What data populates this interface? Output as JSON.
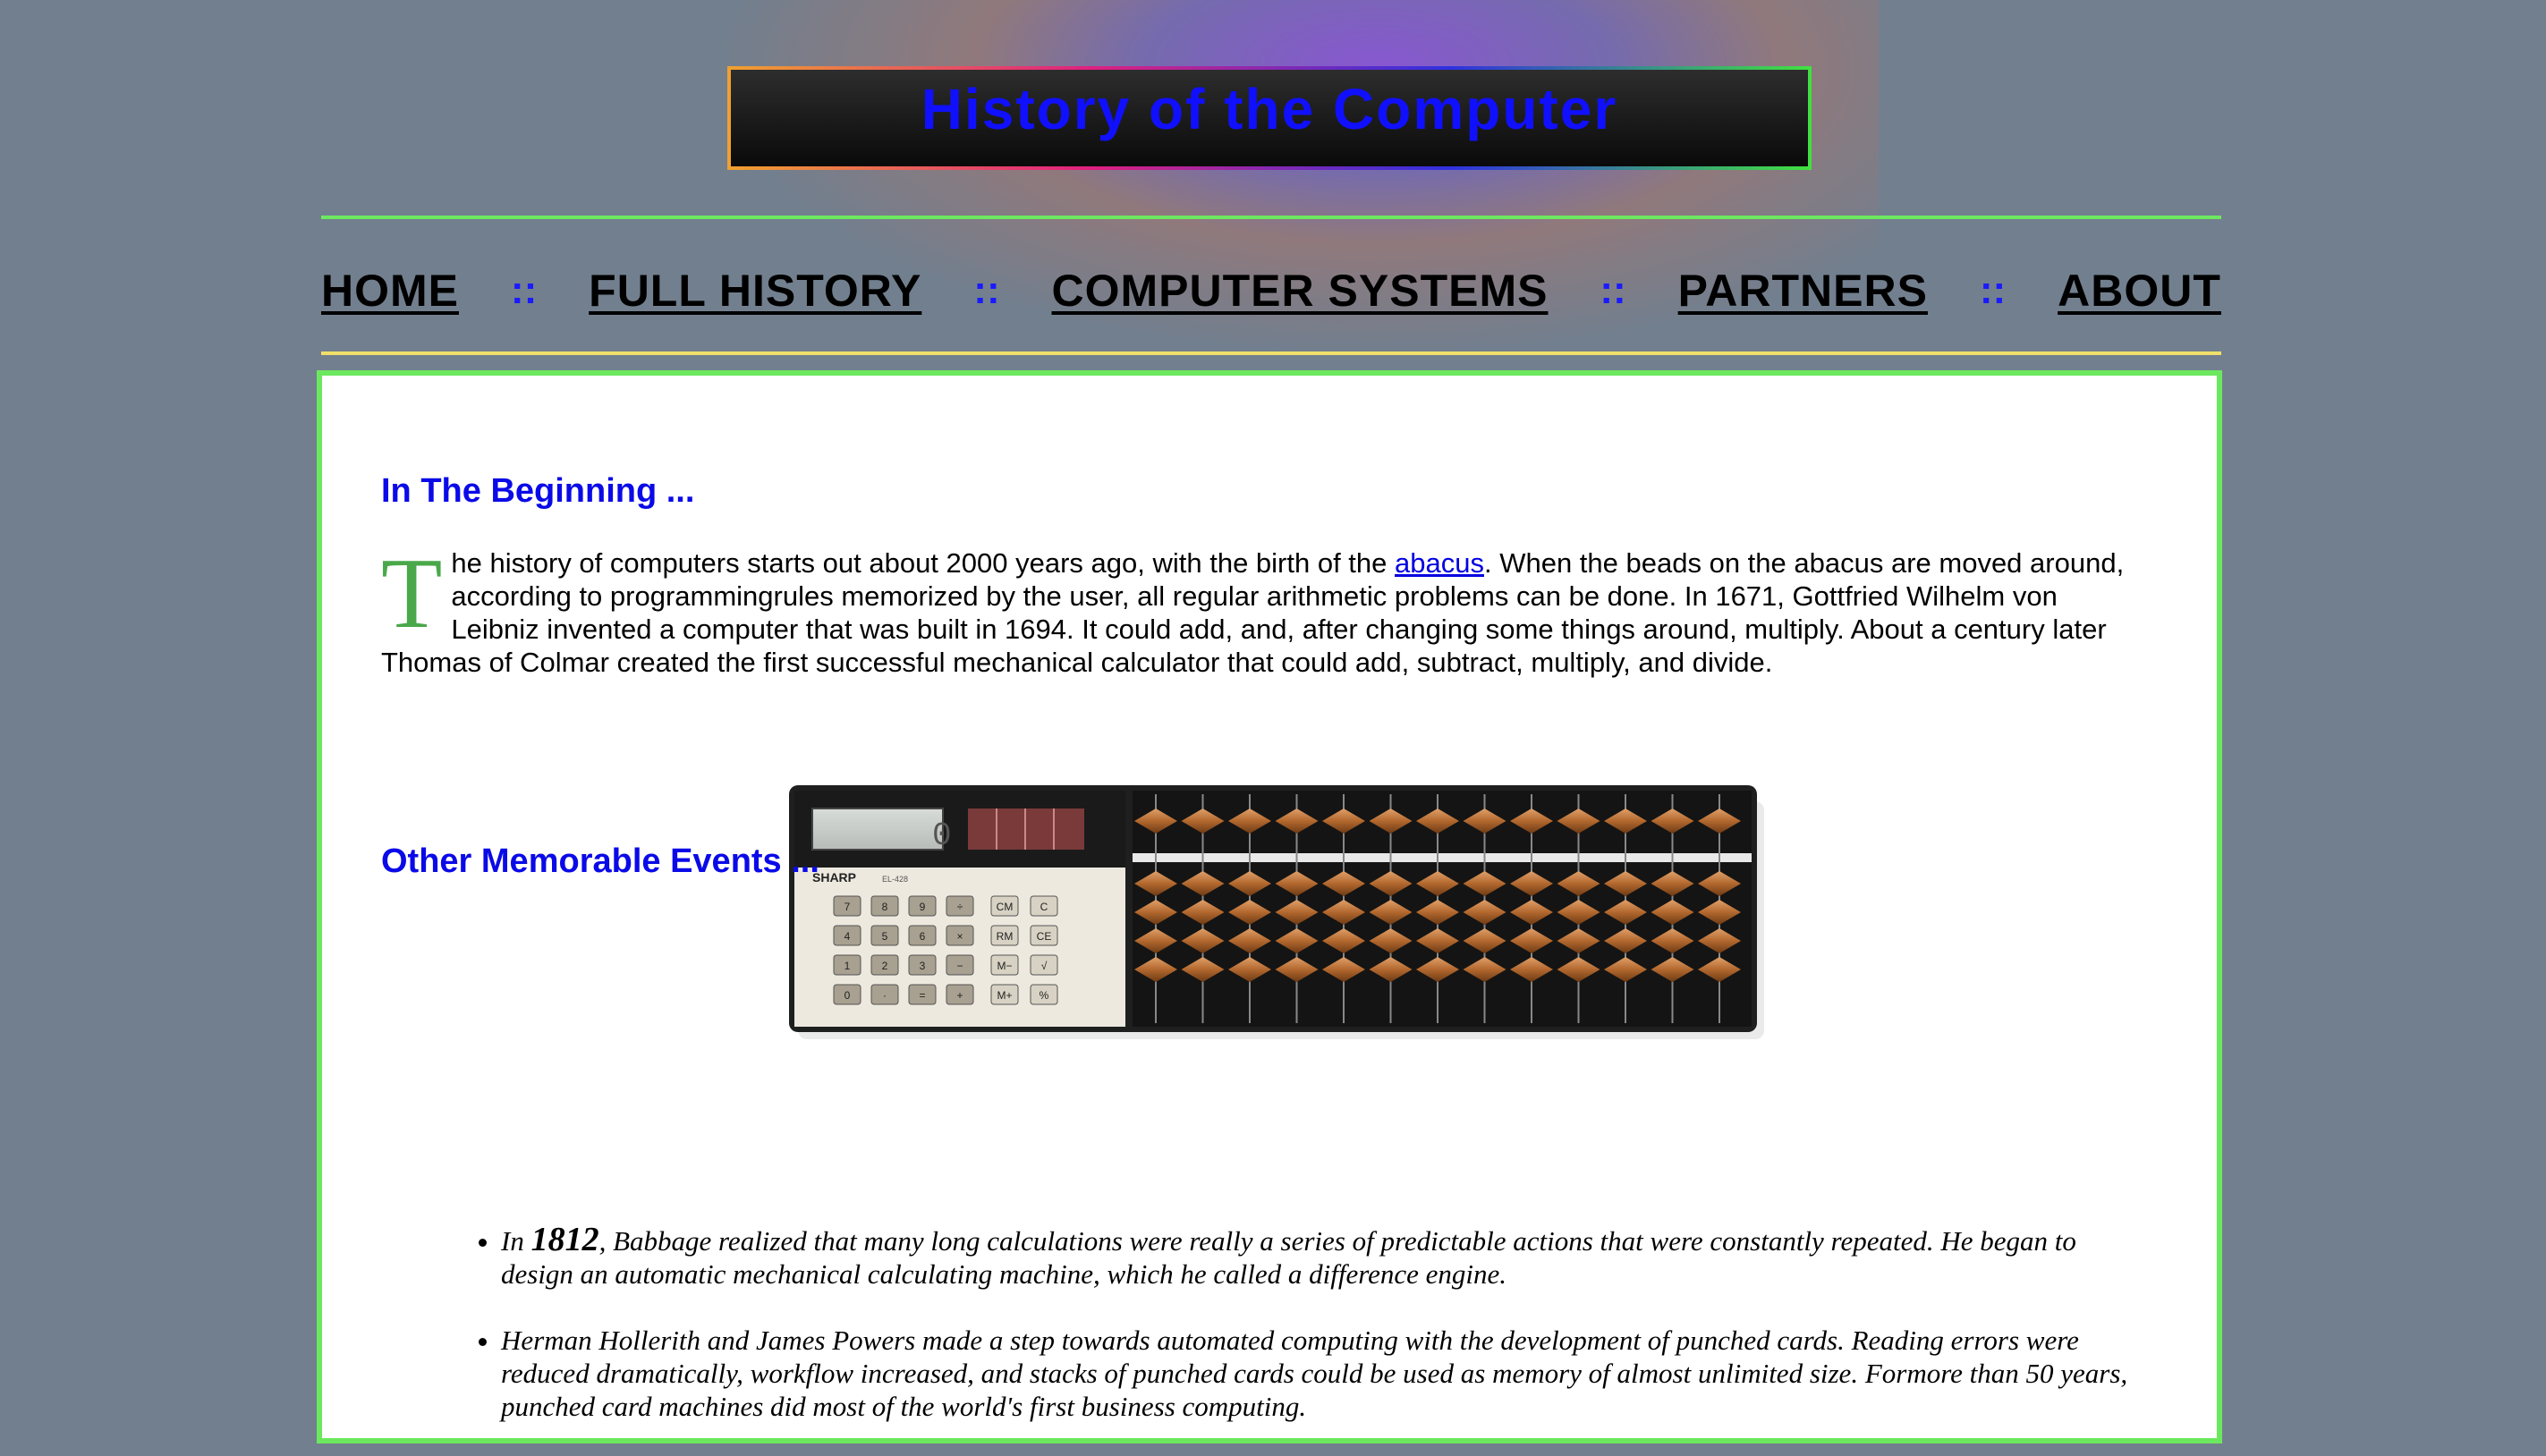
{
  "header": {
    "title": "History of the Computer"
  },
  "nav": {
    "items": [
      "HOME",
      "FULL HISTORY",
      "COMPUTER SYSTEMS",
      "PARTNERS",
      "ABOUT"
    ],
    "separator": "::"
  },
  "section1": {
    "heading": "In The Beginning ...",
    "drop_cap": "T",
    "text_before_link": "he history of computers starts out about 2000 years ago, with the birth of the ",
    "link": "abacus",
    "text_after_link": ". When the beads on the abacus are moved around, according to programmingrules memorized by the user, all regular arithmetic problems can be done. In 1671, Gottfried Wilhelm von Leibniz invented a computer that was built in 1694. It could add, and, after changing some things around, multiply. About a century later Thomas of Colmar created the first successful mechanical calculator that could add, subtract, multiply, and divide."
  },
  "image": {
    "brand": "SHARP",
    "model": "EL-428",
    "calc_keys": [
      "7",
      "8",
      "9",
      "÷",
      "CM",
      "C",
      "4",
      "5",
      "6",
      "×",
      "RM",
      "CE",
      "1",
      "2",
      "3",
      "−",
      "M−",
      "√",
      "0",
      "·",
      "=",
      "+",
      "M+",
      "%"
    ]
  },
  "section2": {
    "heading": "Other Memorable Events ...",
    "items": [
      {
        "prefix": "In ",
        "year": "1812",
        "text": ", Babbage realized that many long calculations were really a series of predictable actions that were constantly repeated. He began to design an automatic mechanical calculating machine, which he called a difference engine."
      },
      {
        "prefix": "",
        "year": "",
        "text": "Herman Hollerith and James Powers made a step towards automated computing with the development of punched cards. Reading errors were reduced dramatically, workflow increased, and stacks of punched cards could be used as memory of almost unlimited size. Formore than 50 years, punched card machines did most of the world's first business computing."
      }
    ]
  }
}
